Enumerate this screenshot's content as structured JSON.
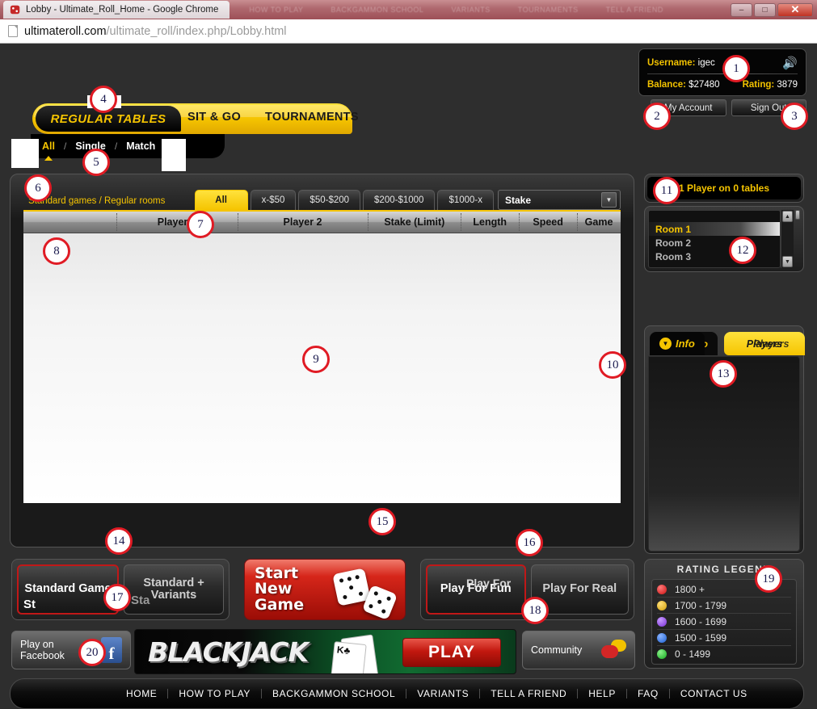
{
  "browser": {
    "tab_title": "Lobby - Ultimate_Roll_Home - Google Chrome",
    "url_host": "ultimateroll.com",
    "url_path": "/ultimate_roll/index.php/Lobby.html",
    "minimize": "–",
    "maximize": "□",
    "close": "✕",
    "ghost_tabs": [
      "HOW TO PLAY",
      "BACKGAMMON SCHOOL",
      "VARIANTS",
      "TOURNAMENTS",
      "TELL A FRIEND"
    ]
  },
  "account": {
    "username_label": "Username:",
    "username_value": "igec",
    "balance_label": "Balance:",
    "balance_value": "$27480",
    "rating_label": "Rating:",
    "rating_value": "3879",
    "sound_icon": "🔊",
    "my_account": "My Account",
    "sign_out": "Sign Out"
  },
  "main_tabs": {
    "active": "REGULAR TABLES",
    "tab2": "SIT & GO",
    "tab3": "TOURNAMENTS"
  },
  "sub_tabs": {
    "all": "All",
    "single": "Single",
    "match": "Match",
    "sep": "/"
  },
  "filters": {
    "title": "Standard games / Regular rooms",
    "buttons": [
      "All",
      "x-$50",
      "$50-$200",
      "$200-$1000",
      "$1000-x"
    ],
    "stake_label": "Stake",
    "stake_arrow": "▼"
  },
  "table": {
    "columns": [
      "Player 1",
      "Player 2",
      "Stake (Limit)",
      "Length",
      "Speed",
      "Game"
    ],
    "rows": []
  },
  "right": {
    "players_status": "1 Player on 0 tables",
    "rooms": [
      "Room 1",
      "Room 2",
      "Room 3"
    ],
    "selected_room": "Room 1",
    "scroll_up": "▲",
    "scroll_down": "▼",
    "info_tab": "Info",
    "info_tab_dup": "Info",
    "players_tab": "Players",
    "players_tab_dup": "Players",
    "chevron": "▼"
  },
  "mode": {
    "standard_game": "Standard Game",
    "standard_game_dup": "St",
    "standard_variants": "Standard + Variants",
    "standard_variants_dup": "Sta",
    "selected": "Standard Game"
  },
  "new_game": {
    "line1": "Start",
    "line2": "New",
    "line3": "Game"
  },
  "play_for": {
    "fun": "Play For Fun",
    "fun_dup": "Play For",
    "real": "Play For Real",
    "selected": "Play For Fun"
  },
  "legend": {
    "title": "RATING LEGEND",
    "rows": [
      {
        "label": "1800 +",
        "color": "#cc1111"
      },
      {
        "label": "1700 - 1799",
        "color": "#d2a007"
      },
      {
        "label": "1600 - 1699",
        "color": "#7b2fd6"
      },
      {
        "label": "1500 - 1599",
        "color": "#1b5fd1"
      },
      {
        "label": "0 - 1499",
        "color": "#13aa1d"
      }
    ]
  },
  "promo": {
    "facebook_line1": "Play on",
    "facebook_line2": "Facebook",
    "facebook_glyph": "f",
    "blackjack_title": "BLACKJACK",
    "blackjack_play": "PLAY",
    "card_left": "K♣",
    "card_right": "♣",
    "community": "Community"
  },
  "footer": {
    "nav": [
      "HOME",
      "HOW TO PLAY",
      "BACKGAMMON SCHOOL",
      "VARIANTS",
      "TELL A FRIEND",
      "HELP",
      "FAQ",
      "CONTACT US"
    ]
  },
  "markers": [
    "1",
    "2",
    "3",
    "4",
    "5",
    "6",
    "7",
    "8",
    "9",
    "10",
    "11",
    "12",
    "13",
    "14",
    "15",
    "16",
    "17",
    "18",
    "19",
    "20"
  ]
}
